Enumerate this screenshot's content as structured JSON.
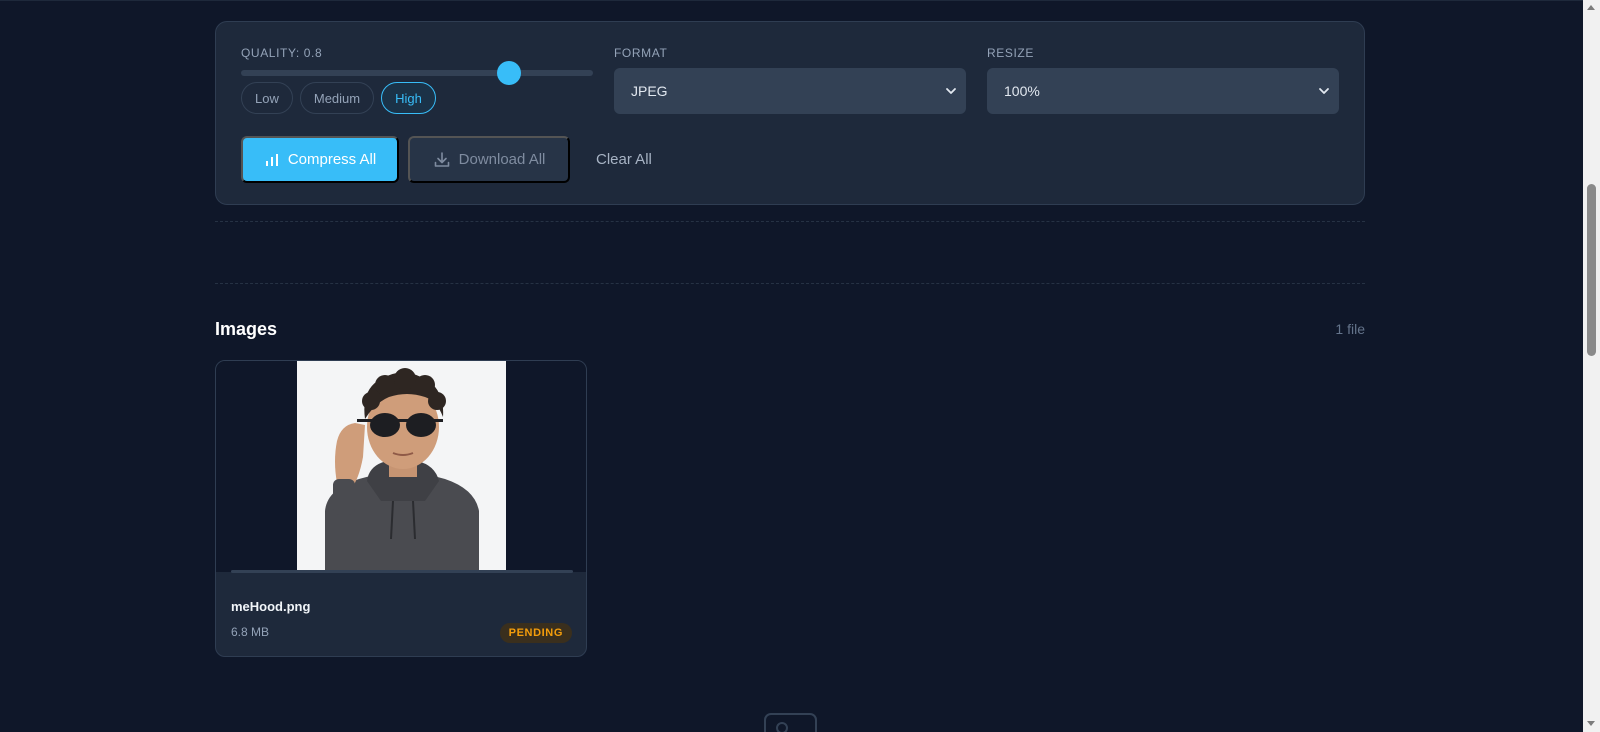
{
  "settings": {
    "quality_label": "QUALITY: 0.8",
    "quality_value": 0.8,
    "quality_slider_position": 0.76,
    "presets": [
      {
        "label": "Low",
        "active": false
      },
      {
        "label": "Medium",
        "active": false
      },
      {
        "label": "High",
        "active": true
      }
    ],
    "format_label": "FORMAT",
    "format_value": "JPEG",
    "resize_label": "RESIZE",
    "resize_value": "100%"
  },
  "actions": {
    "compress_label": "Compress All",
    "download_label": "Download All",
    "clear_label": "Clear All"
  },
  "images_section": {
    "title": "Images",
    "count": "1 file"
  },
  "files": [
    {
      "name": "meHood.png",
      "size": "6.8 MB",
      "status": "PENDING",
      "progress": 0
    }
  ],
  "colors": {
    "background": "#0f1729",
    "panel": "#1e293b",
    "accent": "#38bdf8",
    "pending": "#f59e0b"
  },
  "icons": {
    "compress": "bar-chart-icon",
    "download": "download-icon",
    "select_caret": "chevron-down-icon",
    "dropzone": "image-icon"
  }
}
